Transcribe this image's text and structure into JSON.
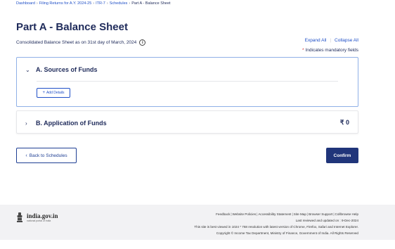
{
  "breadcrumb": {
    "items": [
      "Dashboard",
      "Filing Returns for A.Y. 2024-25",
      "ITR-7",
      "Schedules"
    ],
    "current": "Part A - Balance Sheet",
    "separator": "›"
  },
  "page": {
    "title": "Part A - Balance Sheet",
    "subtitle": "Consolidated Balance Sheet as on 31st day of March, 2024",
    "info_icon": "i"
  },
  "actions": {
    "expand_all": "Expand All",
    "collapse_all": "Collapse All",
    "mandatory_star": "*",
    "mandatory_note": "Indicates mandatory fields"
  },
  "sections": [
    {
      "chevron": "⌄",
      "title": "A. Sources of Funds",
      "add_details": "Add Details",
      "add_plus": "+"
    },
    {
      "chevron": "›",
      "title": "B. Application of Funds",
      "amount": "₹ 0"
    }
  ],
  "buttons": {
    "back_arrow": "‹",
    "back": "Back to Schedules",
    "confirm": "Confirm"
  },
  "footer": {
    "logo_main": "india.gov.in",
    "logo_sub": "national portal of india",
    "links": [
      "Feedback",
      "Website Policies",
      "Accessibility Statement",
      "Site Map",
      "Browser Support",
      "Collbrowse Help"
    ],
    "link_separator": "|",
    "updated": "Last reviewed and updated on : 9-Dec-2024",
    "resolution": "This site is best viewed in 1024 * 768 resolution with latest version of Chrome, Firefox, Safari and Internet Explorer.",
    "copyright": "Copyright © Income Tax Department, Ministry of Finance, Government of India. All Rights Reserved"
  },
  "colors": {
    "primary": "#20357a",
    "link": "#1f4fc7",
    "active_border": "#8fb0e6",
    "footer_bg": "#f2f2f4"
  }
}
